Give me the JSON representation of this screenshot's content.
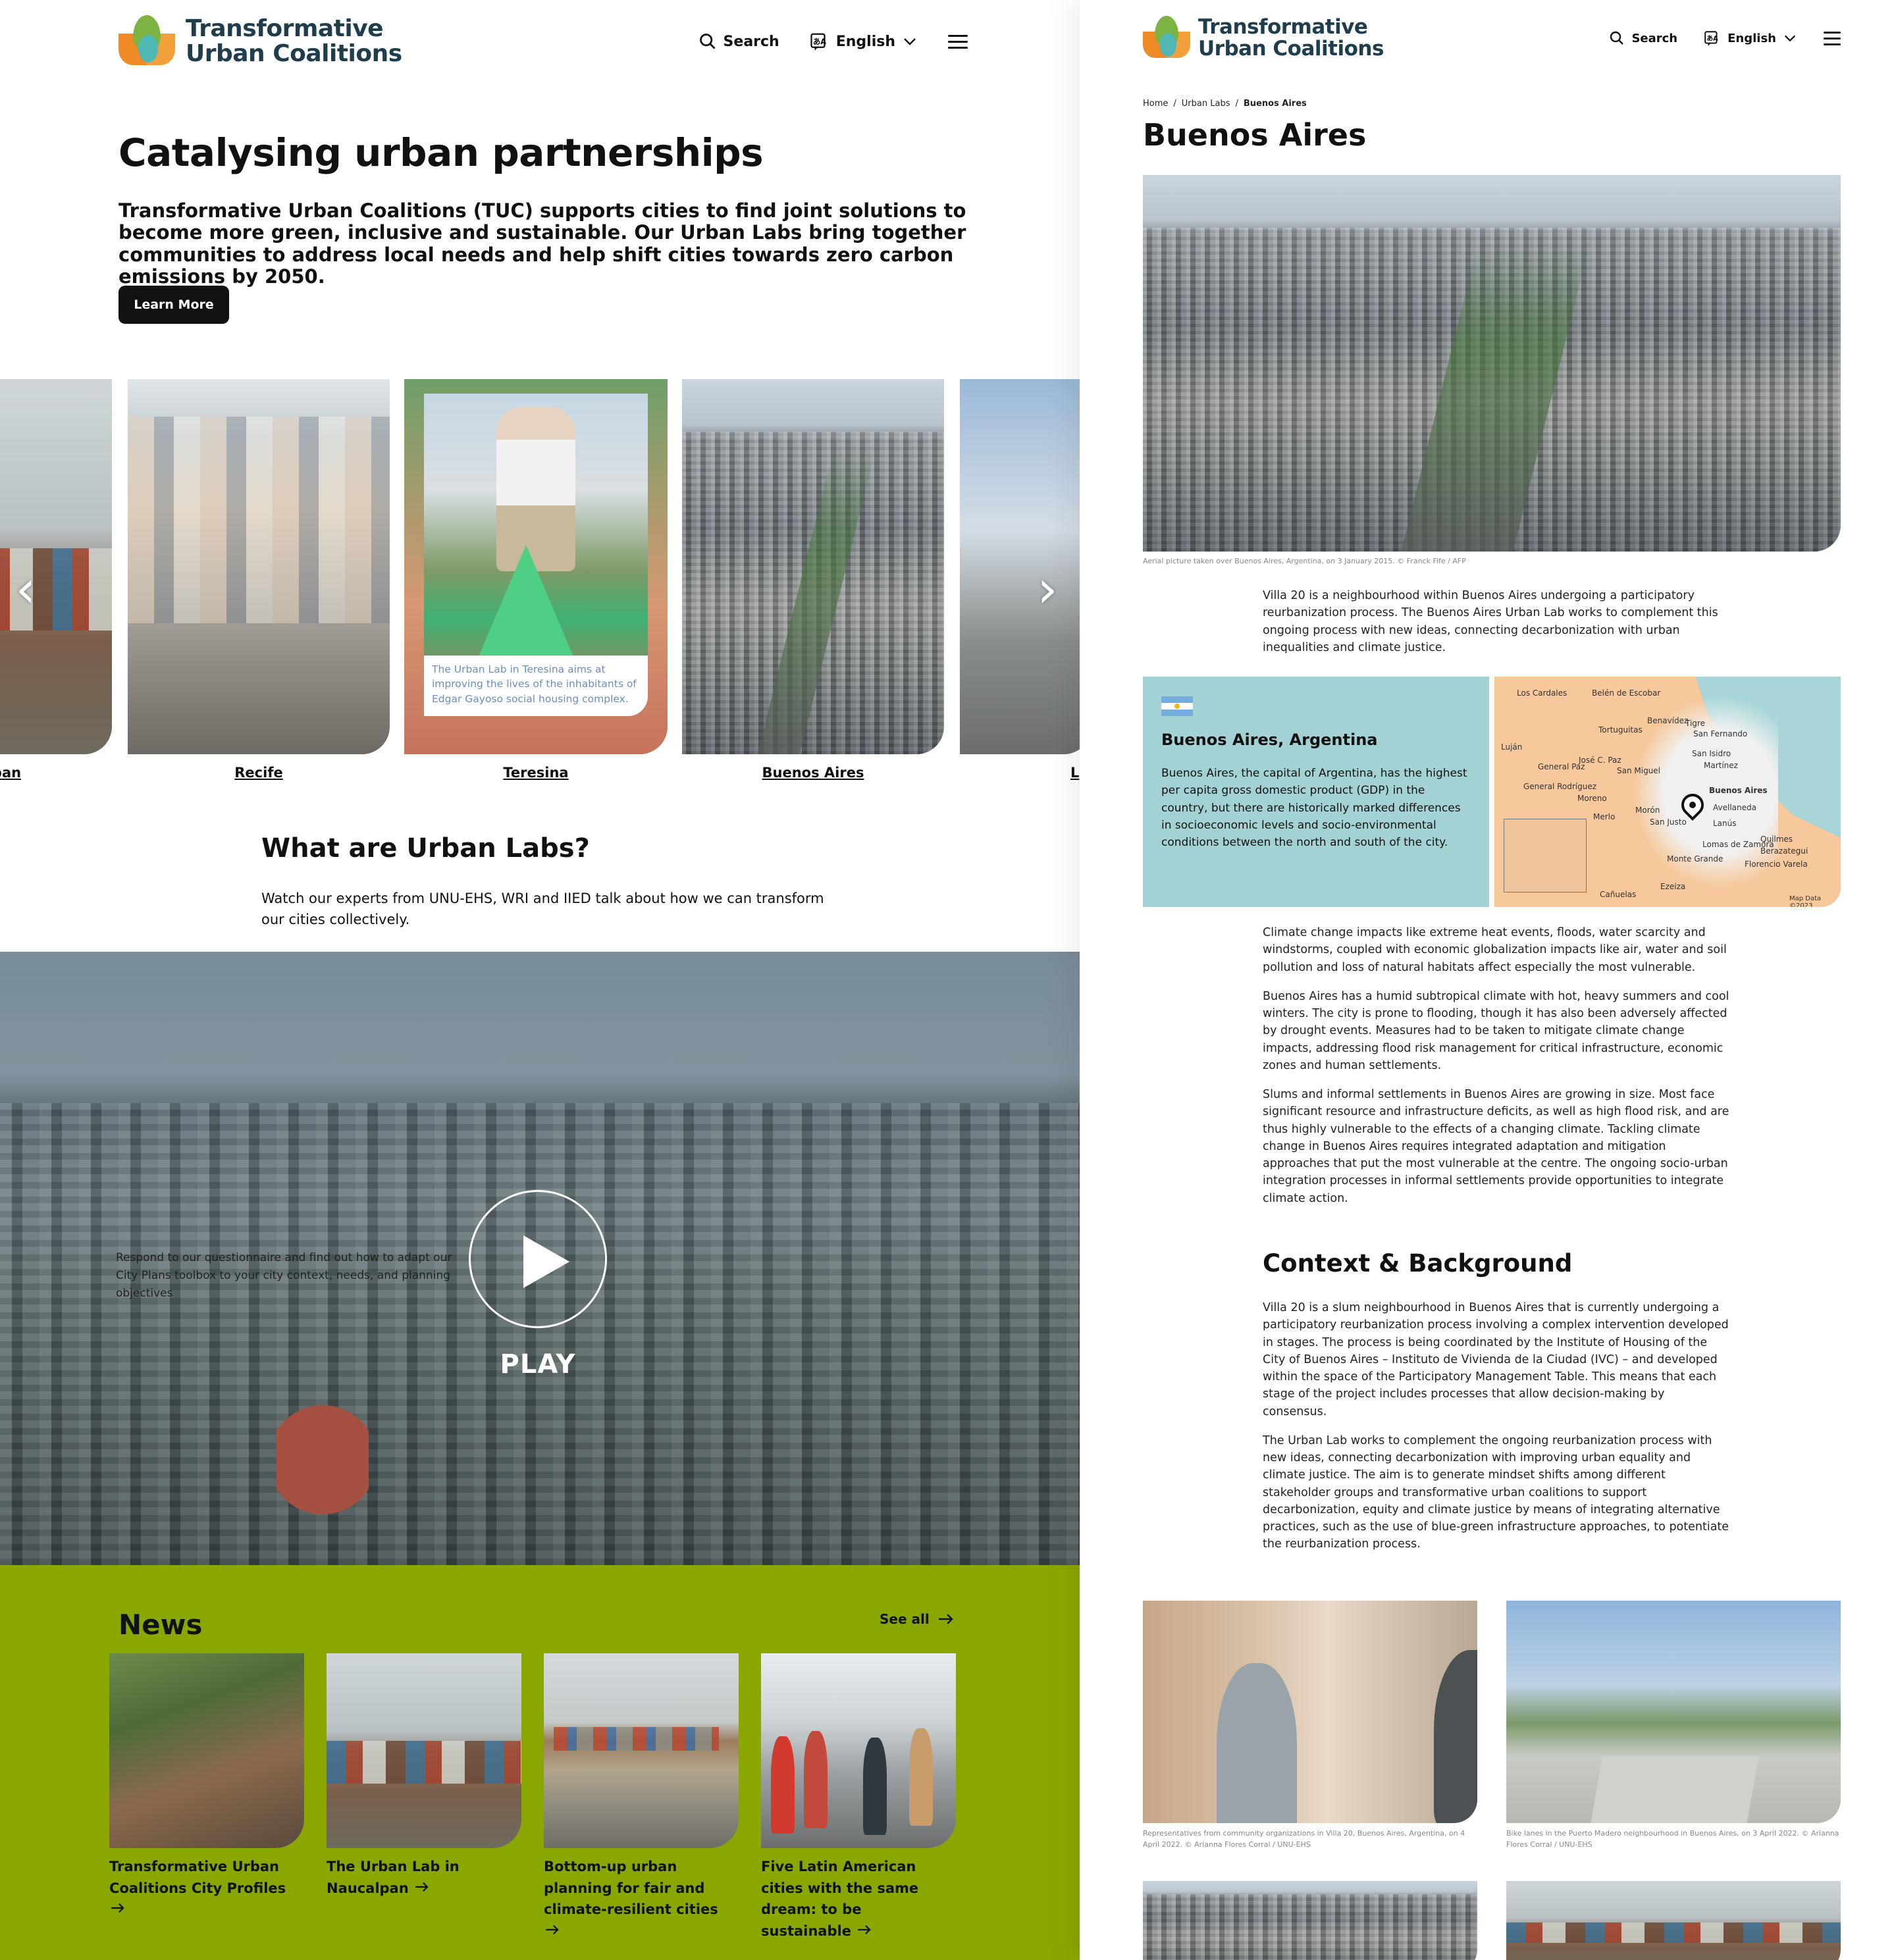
{
  "left": {
    "logo": {
      "line1": "Transformative",
      "line2": "Urban Coalitions"
    },
    "nav": {
      "search": "Search",
      "language": "English"
    },
    "hero": {
      "title": "Catalysing urban partnerships",
      "text": "Transformative Urban Coalitions (TUC) supports cities to find joint solutions to become more green, inclusive and sustainable. Our Urban Labs bring together communities to address local needs and help shift cities towards zero carbon emissions by 2050.",
      "button": "Learn More"
    },
    "carousel": {
      "cards": [
        {
          "label": "pan"
        },
        {
          "label": "Recife"
        },
        {
          "label": "Teresina",
          "caption": "The Urban Lab in Teresina aims at improving the lives of the inhabitants of Edgar Gayoso social housing complex."
        },
        {
          "label": "Buenos Aires"
        },
        {
          "label": "L"
        }
      ],
      "prev": "‹",
      "next": "›"
    },
    "labs": {
      "title": "What are Urban Labs?",
      "text": "Watch our experts from UNU-EHS, WRI and IIED talk about how we can transform our cities collectively."
    },
    "video": {
      "prompt": "Respond to our questionnaire and find out how to adapt our City Plans toolbox to your city context, needs, and planning objectives",
      "play": "PLAY"
    },
    "news": {
      "title": "News",
      "see_all": "See all",
      "items": [
        {
          "title": "Transformative Urban Coalitions City Profiles"
        },
        {
          "title": "The Urban Lab in Naucalpan"
        },
        {
          "title": "Bottom-up urban planning for fair and climate-resilient cities"
        },
        {
          "title": "Five Latin American cities with the same dream: to be sustainable"
        }
      ]
    }
  },
  "right": {
    "logo": {
      "line1": "Transformative",
      "line2": "Urban Coalitions"
    },
    "nav": {
      "search": "Search",
      "language": "English"
    },
    "breadcrumb": {
      "home": "Home",
      "sep": "/",
      "section": "Urban Labs",
      "current": "Buenos Aires"
    },
    "title": "Buenos Aires",
    "hero_caption": "Aerial picture taken over Buenos Aires, Argentina, on 3 January 2015. © Franck Fife / AFP",
    "intro": "Villa 20 is a neighbourhood within Buenos Aires undergoing a participatory reurbanization process. The Buenos Aires Urban Lab works to complement this ongoing process with new ideas, connecting decarbonization with urban inequalities and climate justice.",
    "info": {
      "title": "Buenos Aires, Argentina",
      "text": "Buenos Aires, the capital of Argentina, has the highest per capita gross domestic product (GDP) in the country, but there are historically marked differences in socioeconomic levels and socio-environmental conditions between the north and south of the city."
    },
    "map": {
      "labels": [
        "Los Cardales",
        "Belén de Escobar",
        "Tortuguitas",
        "Benavídez",
        "Tigre",
        "San Fernando",
        "José C. Paz",
        "San Isidro",
        "Martínez",
        "San Miguel",
        "Luján",
        "General Rodríguez",
        "Moreno",
        "Merlo",
        "Morón",
        "San Justo",
        "Buenos Aires",
        "Avellaneda",
        "Lanús",
        "Quilmes",
        "Lomas de Zamora",
        "Monte Grande",
        "Berazategui",
        "Florencio Varela",
        "Ezeiza",
        "Cañuelas",
        "General Paz",
        "Map Data ©2023"
      ]
    },
    "body1": [
      "Climate change impacts like extreme heat events, floods, water scarcity and windstorms, coupled with economic globalization impacts like air, water and soil pollution and loss of natural habitats affect especially the most vulnerable.",
      "Buenos Aires has a humid subtropical climate with hot, heavy summers and cool winters. The city is prone to flooding, though it has also been adversely affected by drought events. Measures had to be taken to mitigate climate change impacts, addressing flood risk management for critical infrastructure, economic zones and human settlements.",
      "Slums and informal settlements in Buenos Aires are growing in size. Most face significant resource and infrastructure deficits, as well as high flood risk, and are thus highly vulnerable to the effects of a changing climate. Tackling climate change in Buenos Aires requires integrated adaptation and mitigation approaches that put the most vulnerable at the centre. The ongoing socio-urban integration processes in informal settlements provide opportunities to integrate climate action."
    ],
    "context": {
      "title": "Context & Background",
      "paragraphs": [
        "Villa 20 is a slum neighbourhood in Buenos Aires that is currently undergoing a participatory reurbanization process involving a complex intervention developed in stages. The process is being coordinated by the Institute of Housing of the City of Buenos Aires – Instituto de Vivienda de la Ciudad (IVC) – and developed within the space of the Participatory Management Table. This means that each stage of the project includes processes that allow decision-making by consensus.",
        "The Urban Lab works to complement the ongoing reurbanization process with new ideas, connecting decarbonization with improving urban equality and climate justice. The aim is to generate mindset shifts among different stakeholder groups and transformative urban coalitions to support decarbonization, equity and climate justice by means of integrating alternative practices, such as the use of blue-green infrastructure approaches, to potentiate the reurbanization process."
      ]
    },
    "gallery": [
      {
        "caption": "Representatives from community organizations in Villa 20, Buenos Aires, Argentina, on 4 April 2022. © Arianna Flores Corral / UNU-EHS"
      },
      {
        "caption": "Bike lanes in the Puerto Madero neighbourhood in Buenos Aires, on 3 April 2022. © Arianna Flores Corral / UNU-EHS"
      }
    ]
  },
  "colors": {
    "news_bg": "#8aa700",
    "info_bg": "#a3d2d4",
    "logo_text": "#1f3d4c",
    "button_dark": "#111111"
  },
  "icons": {
    "search": "search-icon",
    "language": "translate-icon",
    "dropdown": "chevron-down-icon",
    "menu": "hamburger-icon",
    "arrow": "arrow-right-icon",
    "play": "play-icon",
    "pin": "map-pin-icon"
  }
}
